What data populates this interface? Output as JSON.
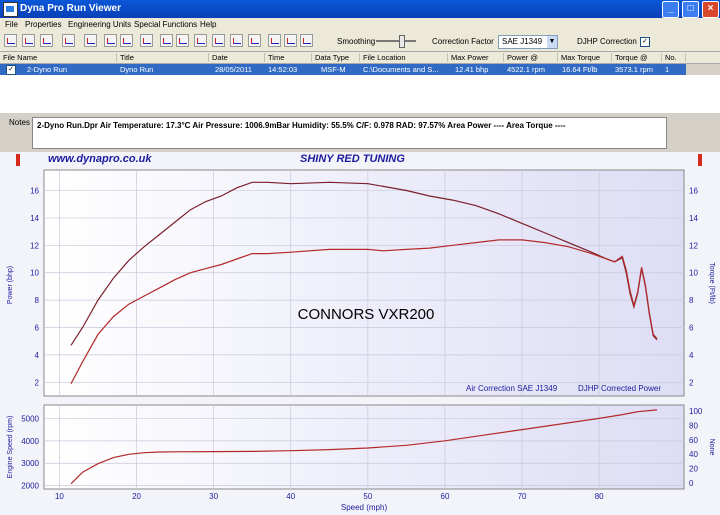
{
  "window": {
    "title": "Dyna Pro Run Viewer"
  },
  "menu": [
    "File",
    "Properties",
    "Engineering Units",
    "Special Functions",
    "Help"
  ],
  "toolbar": {
    "smoothing_label": "Smoothing",
    "correction_label": "Correction Factor",
    "correction_value": "SAE J1349",
    "djhp_label": "DJHP Correction",
    "djhp_checked": "✓"
  },
  "grid": {
    "headers": [
      "File Name",
      "Title",
      "Date",
      "Time",
      "Data Type",
      "File Location",
      "Max Power",
      "Power @",
      "Max Torque",
      "Torque @",
      "No."
    ],
    "row": {
      "check": "✓",
      "cells": [
        "2-Dyno Run",
        "Dyno Run",
        "28/05/2011",
        "14:52:03",
        "MSF-M",
        "C:\\Documents and S...",
        "12.41 bhp",
        "4522.1 rpm",
        "16.64 Ft/lb",
        "3573.1 rpm",
        "1"
      ]
    }
  },
  "notes": {
    "label": "Notes",
    "text": "2-Dyno Run.Dpr   Air Temperature: 17.3°C   Air Pressure: 1006.9mBar   Humidity: 55.5%   C/F: 0.978   RAD: 97.57%   Area Power ----   Area Torque ----"
  },
  "chart_header": {
    "url": "www.dynapro.co.uk",
    "tuner": "SHINY RED TUNING"
  },
  "chart_data": [
    {
      "type": "line",
      "annotation": "CONNORS VXR200",
      "footer_left": "Air Correction SAE J1349",
      "footer_right": "DJHP Corrected Power",
      "ylabel_left": "Power (bhp)",
      "ylabel_right": "Torque (Ft/lb)",
      "yticks": [
        2,
        4,
        6,
        8,
        10,
        12,
        14,
        16
      ],
      "ylim": [
        1,
        17.5
      ],
      "xlim": [
        8,
        91
      ],
      "series": [
        {
          "color": "#7a1f2a",
          "x": [
            11.5,
            13,
            15,
            17,
            19,
            21,
            23,
            25,
            27,
            29,
            31,
            33,
            35,
            37,
            40,
            45,
            50,
            52,
            55,
            58,
            61,
            64,
            67,
            70,
            73,
            76,
            79,
            81,
            82,
            83,
            83.5,
            84,
            84.5,
            85,
            85.5,
            86,
            86.5,
            87,
            87.5
          ],
          "values": [
            4.7,
            6.0,
            8.0,
            9.6,
            10.9,
            11.9,
            12.8,
            13.7,
            14.6,
            15.2,
            15.6,
            16.2,
            16.6,
            16.6,
            16.5,
            16.6,
            16.5,
            16.3,
            16.0,
            15.6,
            15.3,
            14.9,
            14.3,
            13.6,
            12.9,
            12.2,
            11.5,
            11.0,
            10.8,
            11.1,
            10.0,
            8.5,
            7.5,
            8.5,
            10.3,
            9.0,
            7.0,
            5.4,
            5.1
          ]
        },
        {
          "color": "#b22a2a",
          "x": [
            11.5,
            13,
            15,
            17,
            19,
            21,
            23,
            25,
            27,
            29,
            31,
            33,
            35,
            37,
            40,
            45,
            50,
            52,
            55,
            58,
            61,
            64,
            67,
            70,
            73,
            76,
            79,
            81,
            82,
            83,
            83.5,
            84,
            84.5,
            85,
            85.5,
            86,
            86.5,
            87,
            87.5
          ],
          "values": [
            1.9,
            3.5,
            5.5,
            6.8,
            7.7,
            8.3,
            8.9,
            9.5,
            10.0,
            10.3,
            10.6,
            11.0,
            11.4,
            11.4,
            11.5,
            11.7,
            11.7,
            11.6,
            11.7,
            11.8,
            12.0,
            12.2,
            12.4,
            12.4,
            12.2,
            11.9,
            11.4,
            11.0,
            10.8,
            11.2,
            10.2,
            8.7,
            7.6,
            8.6,
            10.4,
            9.1,
            7.1,
            5.5,
            5.2
          ]
        }
      ]
    },
    {
      "type": "line",
      "xlabel": "Speed (mph)",
      "ylabel_left": "Engine Speed (rpm)",
      "ylabel_right": "None",
      "xticks": [
        10,
        20,
        30,
        40,
        50,
        60,
        70,
        80
      ],
      "yticks_left": [
        2000,
        3000,
        4000,
        5000
      ],
      "yticks_right": [
        0,
        20,
        40,
        60,
        80,
        100
      ],
      "xlim": [
        8,
        91
      ],
      "ylim": [
        1850,
        5600
      ],
      "series": [
        {
          "color": "#b22a2a",
          "x": [
            11.5,
            13,
            15,
            17,
            19,
            21,
            23,
            25,
            30,
            35,
            40,
            45,
            50,
            55,
            60,
            65,
            70,
            75,
            80,
            83,
            85,
            87.5
          ],
          "values": [
            2080,
            2600,
            2980,
            3250,
            3400,
            3470,
            3500,
            3510,
            3520,
            3530,
            3560,
            3610,
            3680,
            3800,
            4000,
            4250,
            4500,
            4750,
            5000,
            5170,
            5300,
            5380
          ]
        }
      ]
    }
  ]
}
